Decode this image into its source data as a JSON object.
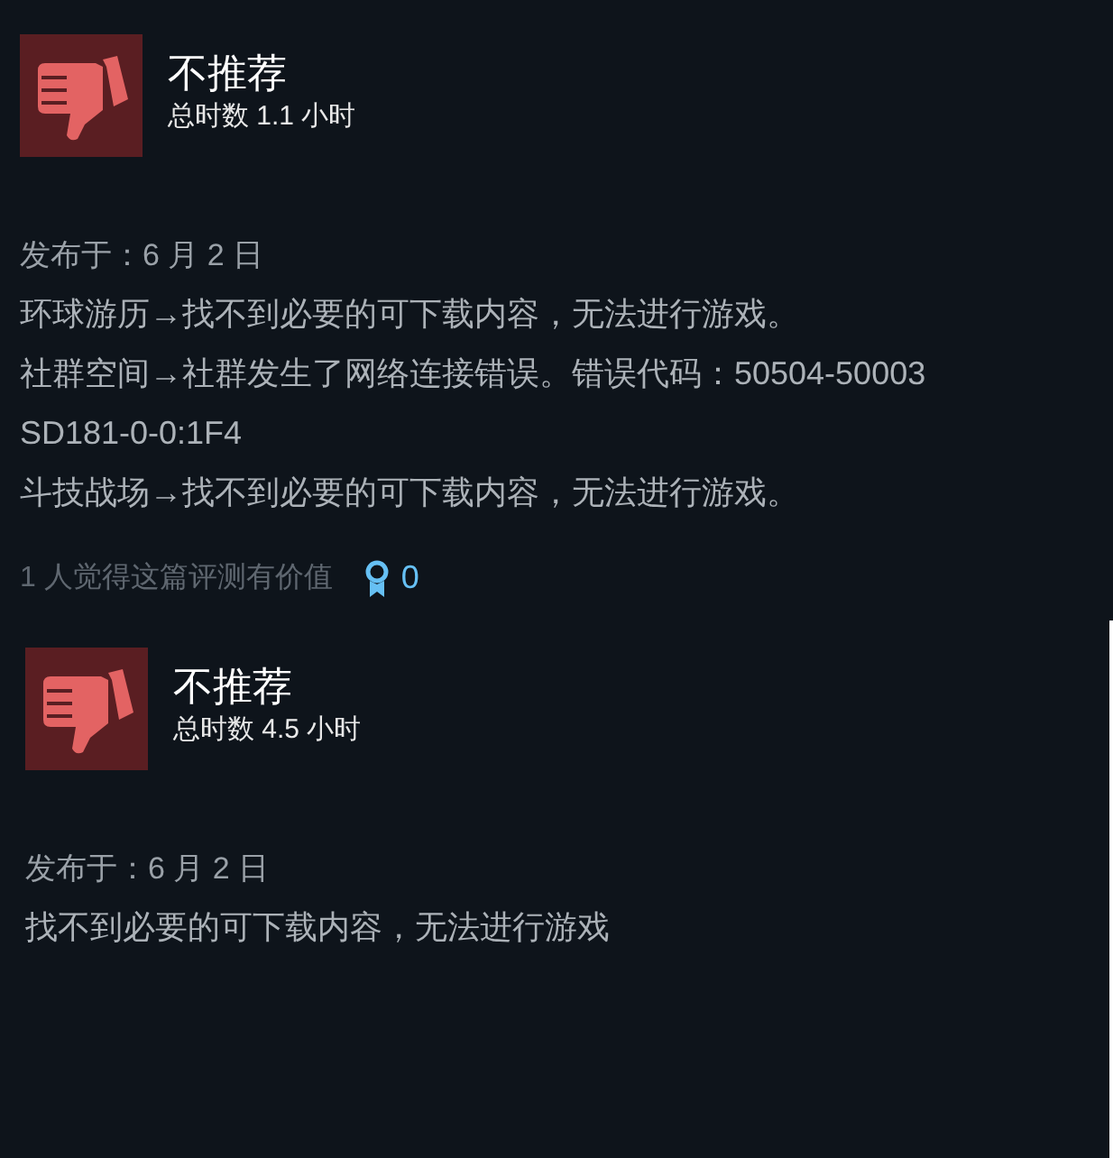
{
  "reviews": [
    {
      "kind": "negative",
      "recommendation": "不推荐",
      "hours": "总时数 1.1 小时",
      "posted": "发布于：6 月 2 日",
      "lines": [
        "环球游历→找不到必要的可下载内容，无法进行游戏。",
        "社群空间→社群发生了网络连接错误。错误代码：50504-50003",
        "SD181-0-0:1F4",
        "斗技战场→找不到必要的可下载内容，无法进行游戏。"
      ],
      "helpful": "1 人觉得这篇评测有价值",
      "awards": "0"
    },
    {
      "kind": "negative",
      "recommendation": "不推荐",
      "hours": "总时数 4.5 小时",
      "posted": "发布于：6 月 2 日",
      "lines": [
        "找不到必要的可下载内容，无法进行游戏"
      ]
    }
  ]
}
